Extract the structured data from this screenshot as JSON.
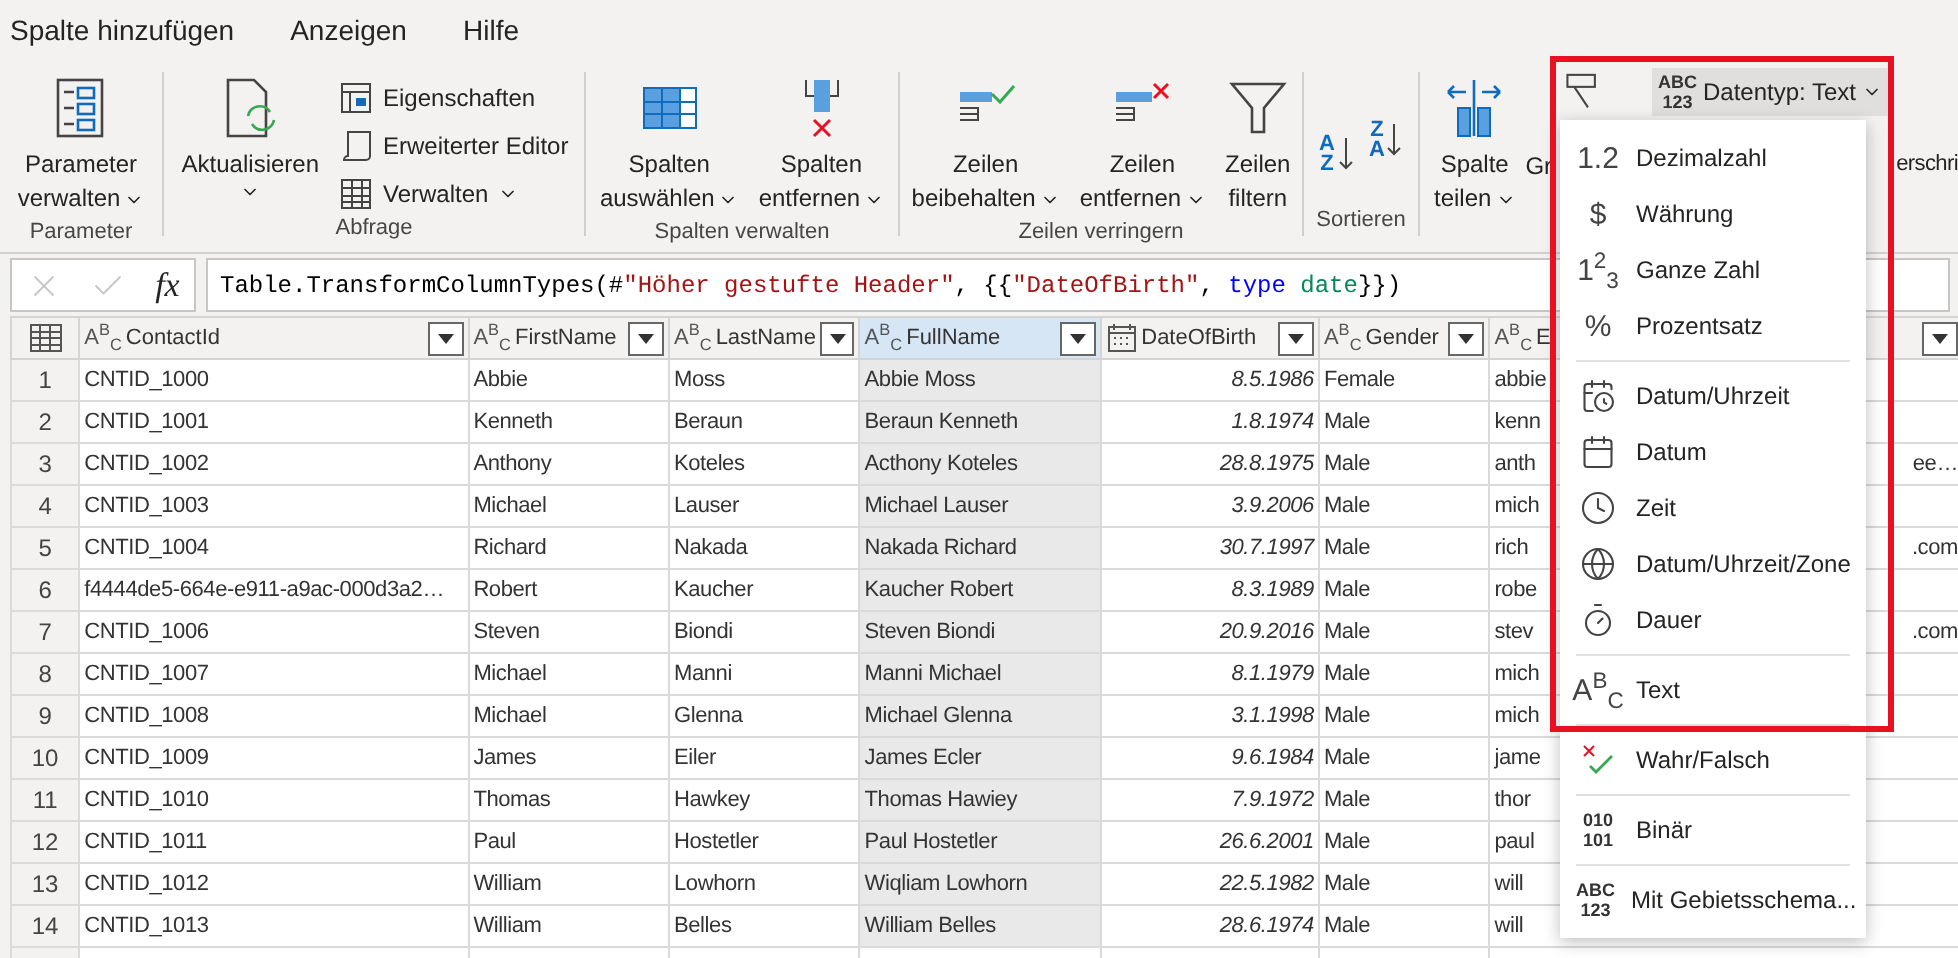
{
  "menu_tabs": [
    {
      "label": "Spalte hinzufügen",
      "selected": false
    },
    {
      "label": "Anzeigen",
      "selected": false
    },
    {
      "label": "Hilfe",
      "selected": false
    }
  ],
  "ribbon": {
    "groups": [
      {
        "label": "Parameter",
        "buttons": [
          {
            "kind": "large",
            "lines": [
              "Parameter",
              "verwalten"
            ],
            "dropdown": true
          }
        ]
      },
      {
        "label": "Abfrage",
        "buttons": [
          {
            "kind": "large",
            "lines": [
              "Aktualisieren"
            ],
            "dropdown": true
          },
          {
            "kind": "small",
            "lines": [
              "Eigenschaften"
            ],
            "dropdown": false
          },
          {
            "kind": "small",
            "lines": [
              "Erweiterter Editor"
            ],
            "dropdown": false
          },
          {
            "kind": "small",
            "lines": [
              "Verwalten"
            ],
            "dropdown": true
          }
        ]
      },
      {
        "label": "Spalten verwalten",
        "buttons": [
          {
            "kind": "large",
            "lines": [
              "Spalten",
              "auswählen"
            ],
            "dropdown": true
          },
          {
            "kind": "large",
            "lines": [
              "Spalten",
              "entfernen"
            ],
            "dropdown": true
          }
        ]
      },
      {
        "label": "Zeilen verringern",
        "buttons": [
          {
            "kind": "large",
            "lines": [
              "Zeilen",
              "beibehalten"
            ],
            "dropdown": true
          },
          {
            "kind": "large",
            "lines": [
              "Zeilen",
              "entfernen"
            ],
            "dropdown": true
          },
          {
            "kind": "large",
            "lines": [
              "Zeilen",
              "filtern"
            ],
            "dropdown": false
          }
        ]
      },
      {
        "label": "Sortieren",
        "buttons": [
          {
            "kind": "sort",
            "lines": [
              "A",
              "Z"
            ]
          },
          {
            "kind": "sort",
            "lines": [
              "Z",
              "A"
            ]
          }
        ]
      },
      {
        "buttons": [
          {
            "kind": "large",
            "lines": [
              "Spalte",
              "teilen"
            ],
            "dropdown": true
          },
          {
            "kind": "cut",
            "lines": [
              "Gr"
            ]
          }
        ]
      }
    ],
    "cut_label": "erschri"
  },
  "formula_bar": {
    "fx_label": "fx",
    "tokens": [
      {
        "kind": "plain",
        "text": "Table.TransformColumnTypes(#"
      },
      {
        "kind": "string",
        "text": "\"Höher gestufte Header\""
      },
      {
        "kind": "plain",
        "text": ", {{"
      },
      {
        "kind": "string",
        "text": "\"DateOfBirth\""
      },
      {
        "kind": "plain",
        "text": ", "
      },
      {
        "kind": "keyword",
        "text": "type"
      },
      {
        "kind": "type",
        "text": " date"
      },
      {
        "kind": "plain",
        "text": "}})"
      }
    ]
  },
  "table": {
    "columns": [
      {
        "name": "ContactId",
        "kind": "text",
        "type_glyph": "A$^{B}$$_{C}$",
        "selected": false
      },
      {
        "name": "FirstName",
        "kind": "text",
        "type_glyph": "A$^{B}$$_{C}$",
        "selected": false
      },
      {
        "name": "LastName",
        "kind": "text",
        "type_glyph": "A$^{B}$$_{C}$",
        "selected": false
      },
      {
        "name": "FullName",
        "kind": "text",
        "type_glyph": "A$^{B}$$_{C}$",
        "selected": true
      },
      {
        "name": "DateOfBirth",
        "kind": "date",
        "selected": false
      },
      {
        "name": "Gender",
        "kind": "text",
        "type_glyph": "A$^{B}$$_{C}$",
        "selected": false
      },
      {
        "name": "E",
        "kind": "text",
        "type_glyph": "A$^{B}$$_{C}$",
        "selected": false
      }
    ],
    "rows": [
      {
        "number": "1",
        "cells": [
          "CNTID_1000",
          "Abbie",
          "Moss",
          "Abbie Moss",
          "8.5.1986",
          "Female"
        ],
        "email_start": "abbie"
      },
      {
        "number": "2",
        "cells": [
          "CNTID_1001",
          "Kenneth",
          "Beraun",
          "Beraun Kenneth",
          "1.8.1974",
          "Male"
        ],
        "email_start": "kenn"
      },
      {
        "number": "3",
        "cells": [
          "CNTID_1002",
          "Anthony",
          "Koteles",
          "Acthony Koteles",
          "28.8.1975",
          "Male"
        ],
        "email_start": "anth",
        "email_end": "ee…"
      },
      {
        "number": "4",
        "cells": [
          "CNTID_1003",
          "Michael",
          "Lauser",
          "Michael Lauser",
          "3.9.2006",
          "Male"
        ],
        "email_start": "mich"
      },
      {
        "number": "5",
        "cells": [
          "CNTID_1004",
          "Richard",
          "Nakada",
          "Nakada Richard",
          "30.7.1997",
          "Male"
        ],
        "email_start": "rich",
        "email_end": ".com"
      },
      {
        "number": "6",
        "cells": [
          "f4444de5-664e-e911-a9ac-000d3a2…",
          "Robert",
          "Kaucher",
          "Kaucher Robert",
          "8.3.1989",
          "Male"
        ],
        "email_start": "robe"
      },
      {
        "number": "7",
        "cells": [
          "CNTID_1006",
          "Steven",
          "Biondi",
          "Steven Biondi",
          "20.9.2016",
          "Male"
        ],
        "email_start": "stev",
        "email_end": ".com"
      },
      {
        "number": "8",
        "cells": [
          "CNTID_1007",
          "Michael",
          "Manni",
          "Manni Michael",
          "8.1.1979",
          "Male"
        ],
        "email_start": "mich"
      },
      {
        "number": "9",
        "cells": [
          "CNTID_1008",
          "Michael",
          "Glenna",
          "Michael Glenna",
          "3.1.1998",
          "Male"
        ],
        "email_start": "mich"
      },
      {
        "number": "10",
        "cells": [
          "CNTID_1009",
          "James",
          "Eiler",
          "James Ecler",
          "9.6.1984",
          "Male"
        ],
        "email_start": "jame"
      },
      {
        "number": "11",
        "cells": [
          "CNTID_1010",
          "Thomas",
          "Hawkey",
          "Thomas Hawiey",
          "7.9.1972",
          "Male"
        ],
        "email_start": "thor"
      },
      {
        "number": "12",
        "cells": [
          "CNTID_1011",
          "Paul",
          "Hostetler",
          "Paul Hostetler",
          "26.6.2001",
          "Male"
        ],
        "email_start": "paul"
      },
      {
        "number": "13",
        "cells": [
          "CNTID_1012",
          "William",
          "Lowhorn",
          "Wiqliam Lowhorn",
          "22.5.1982",
          "Male"
        ],
        "email_start": "will"
      },
      {
        "number": "14",
        "cells": [
          "CNTID_1013",
          "William",
          "Belles",
          "William Belles",
          "28.6.1974",
          "Male"
        ],
        "email_start": "will"
      }
    ]
  },
  "type_menu": {
    "button": {
      "glyph_lines": [
        "ABC",
        "123"
      ],
      "label": "Datentyp: Text",
      "pressed": true
    },
    "sections": [
      [
        {
          "kind": "glyph",
          "glyph": "1.2",
          "label": "Dezimalzahl"
        },
        {
          "kind": "glyph",
          "glyph": "$",
          "label": "Währung"
        },
        {
          "kind": "glyph",
          "glyph": "1$^{2}$$_{3}$",
          "label": "Ganze Zahl"
        },
        {
          "kind": "glyph",
          "glyph": "%",
          "label": "Prozentsatz"
        }
      ],
      [
        {
          "kind": "datetime",
          "label": "Datum/Uhrzeit"
        },
        {
          "kind": "date",
          "label": "Datum"
        },
        {
          "kind": "time",
          "label": "Zeit"
        },
        {
          "kind": "zone",
          "label": "Datum/Uhrzeit/Zone"
        },
        {
          "kind": "duration",
          "label": "Dauer"
        }
      ],
      [
        {
          "kind": "glyph",
          "glyph": "A$^{B}$$_{C}$",
          "label": "Text"
        }
      ],
      [
        {
          "kind": "boolean",
          "label": "Wahr/Falsch"
        }
      ],
      [
        {
          "kind": "lines",
          "glyph_lines": [
            "010",
            "101"
          ],
          "label": "Binär"
        }
      ],
      [
        {
          "kind": "lines",
          "glyph_lines": [
            "ABC",
            "123"
          ],
          "label": "Mit Gebietsschema..."
        }
      ]
    ]
  }
}
